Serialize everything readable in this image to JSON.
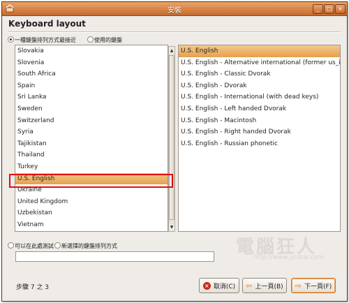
{
  "window": {
    "title": "安裝",
    "controls": [
      "_",
      "□",
      "×"
    ]
  },
  "heading": "Keyboard layout",
  "option_suggest_label": "一種鍵盤排列方式最接近",
  "option_choose_label": "使用的鍵盤",
  "countries": [
    "Slovakia",
    "Slovenia",
    "South Africa",
    "Spain",
    "Sri Lanka",
    "Sweden",
    "Switzerland",
    "Syria",
    "Tajikistan",
    "Thailand",
    "Turkey",
    "U.S. English",
    "Ukraine",
    "United Kingdom",
    "Uzbekistan",
    "Vietnam"
  ],
  "selected_country": "U.S. English",
  "variants": [
    "U.S. English",
    "U.S. English - Alternative international (former us_int",
    "U.S. English - Classic Dvorak",
    "U.S. English - Dvorak",
    "U.S. English - International (with dead keys)",
    "U.S. English - Left handed Dvorak",
    "U.S. English - Macintosh",
    "U.S. English - Right handed Dvorak",
    "U.S. English - Russian phonetic"
  ],
  "selected_variant": "U.S. English",
  "test_label": "可以在此處測試",
  "test_label_2": "新選擇的鍵盤排列方式",
  "test_input_value": "",
  "step_text": "步驟  7 之 3",
  "buttons": {
    "cancel": "取消(C)",
    "back": "上一頁(B)",
    "forward": "下一頁(F)"
  },
  "watermark": "電腦狂人",
  "watermark_sub": "http://www.pcstar.com"
}
